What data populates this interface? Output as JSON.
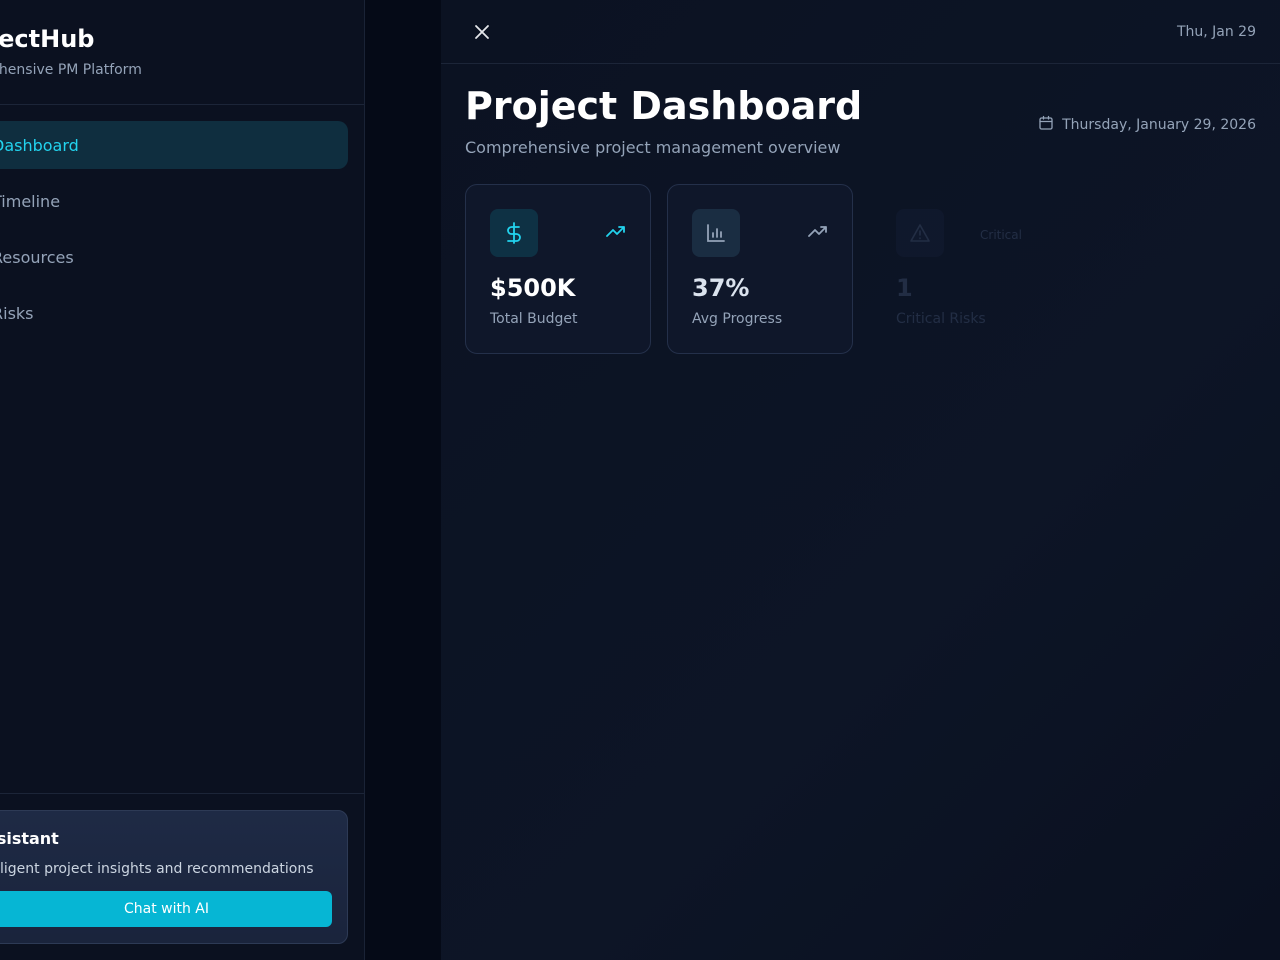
{
  "sidebar": {
    "brand_title": "ProjectHub",
    "brand_subtitle": "Comprehensive PM Platform",
    "nav": [
      {
        "label": "Dashboard",
        "active": true
      },
      {
        "label": "Timeline",
        "active": false
      },
      {
        "label": "Resources",
        "active": false
      },
      {
        "label": "Risks",
        "active": false
      }
    ],
    "assistant": {
      "title": "AI Assistant",
      "description": "Intelligent project insights and recommendations",
      "button_label": "Chat with AI"
    }
  },
  "topbar": {
    "date_short": "Thu, Jan 29"
  },
  "header": {
    "title": "Project Dashboard",
    "subtitle": "Comprehensive project management overview",
    "date_full": "Thursday, January 29, 2026"
  },
  "stats": [
    {
      "value": "$500K",
      "label": "Total Budget",
      "icon": "dollar-icon",
      "trend_icon": "trending-up-icon"
    },
    {
      "value": "37%",
      "label": "Avg Progress",
      "icon": "bar-chart-icon",
      "trend_icon": "trending-up-icon"
    },
    {
      "value": "1",
      "label": "Critical Risks",
      "icon": "alert-triangle-icon",
      "badge": "Critical"
    }
  ],
  "colors": {
    "accent": "#06b6d4",
    "accent_text": "#22d3ee",
    "background": "#0b1120"
  }
}
